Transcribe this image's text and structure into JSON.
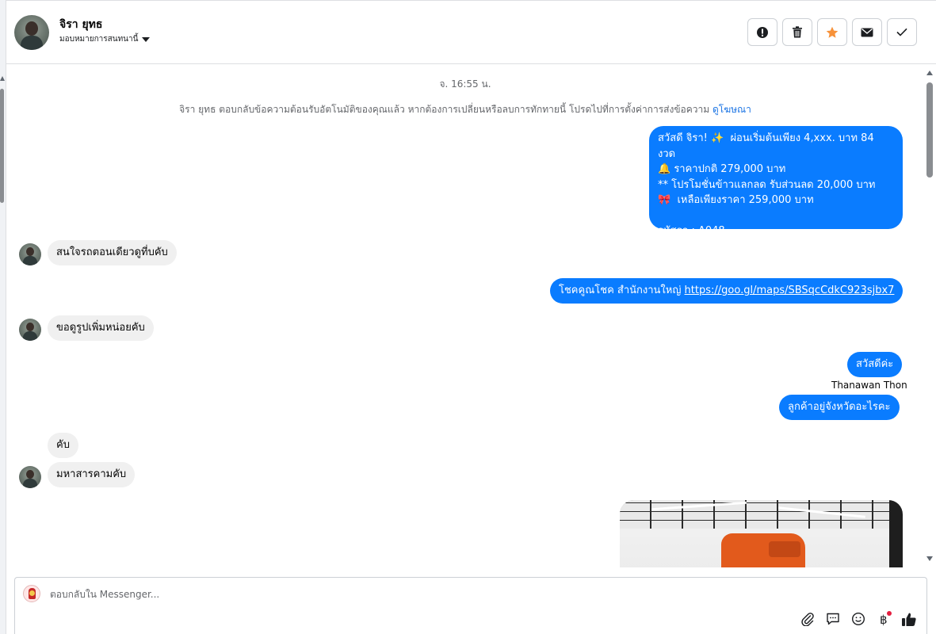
{
  "header": {
    "contact_name": "จิรา ยุทธ",
    "assign_label": "มอบหมายการสนทนานี้",
    "actions": [
      {
        "name": "report-button",
        "icon": "exclamation-circle-icon"
      },
      {
        "name": "delete-button",
        "icon": "trash-icon"
      },
      {
        "name": "star-button",
        "icon": "star-icon",
        "color": "#f7923a"
      },
      {
        "name": "mail-button",
        "icon": "envelope-icon"
      },
      {
        "name": "done-button",
        "icon": "check-icon"
      }
    ]
  },
  "thread": {
    "date": "จ. 16:55 น.",
    "auto_reply_note": "จิรา ยุทธ ตอบกลับข้อความต้อนรับอัตโนมัติของคุณแล้ว หากต้องการเปลี่ยนหรือลบการทักทายนี้ โปรดไปที่การตั้งค่าการส่งข้อความ",
    "auto_reply_link": "ดูโฆษณา",
    "messages": [
      {
        "dir": "out",
        "text": "สวัสดี จิรา! ✨  ผ่อนเริ่มต้นเพียง 4,xxx. บาท 84 งวด\n🔔 ราคาปกติ 279,000 บาท\n** โปรโมชั่นข้าวแลกลด รับส่วนลด 20,000 บาท\n🎀  เหลือเพียงราคา 259,000 บาท\n\nรหัสรถ : A048"
      },
      {
        "dir": "in",
        "text": "สนใจรถตอนเดียวดูที่บคับ"
      },
      {
        "dir": "out",
        "text_prefix": "โชคคูณโชค สำนักงานใหญ่ ",
        "link": "https://goo.gl/maps/SBSqcCdkC923sjbx7"
      },
      {
        "dir": "in",
        "text": "ขอดูรูปเพิ่มหน่อยคับ"
      },
      {
        "dir": "out",
        "text": "สวัสดีค่ะ"
      },
      {
        "dir": "out",
        "sender": "Thanawan Thon",
        "text": "ลูกค้าอยู่จังหวัดอะไรคะ"
      },
      {
        "dir": "in",
        "text": "คับ"
      },
      {
        "dir": "in",
        "text": "มหาสารคามคับ"
      },
      {
        "dir": "out",
        "type": "image",
        "subject": "orange-car-photo"
      }
    ]
  },
  "composer": {
    "placeholder": "ตอบกลับใน Messenger...",
    "tools": [
      "paperclip-icon",
      "quick-reply-icon",
      "emoji-icon",
      "baht-icon",
      "thumbs-up-icon"
    ]
  },
  "colors": {
    "outgoing_bubble": "#0a7cff",
    "incoming_bubble": "#f0f0f0",
    "link": "#1b74e4",
    "star": "#f7923a"
  }
}
